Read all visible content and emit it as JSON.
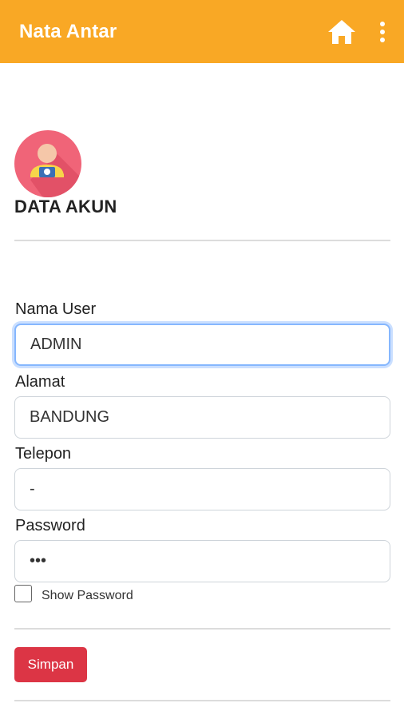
{
  "app_bar": {
    "title": "Nata Antar",
    "home_icon": "home-icon",
    "menu_icon": "more-vert-icon",
    "background_color": "#f9a825"
  },
  "profile": {
    "avatar_icon": "user-avatar-icon",
    "section_title": "DATA AKUN"
  },
  "form": {
    "nama_user": {
      "label": "Nama User",
      "value": "ADMIN"
    },
    "alamat": {
      "label": "Alamat",
      "value": "BANDUNG"
    },
    "telepon": {
      "label": "Telepon",
      "value": "-"
    },
    "password": {
      "label": "Password",
      "value": "aaa"
    },
    "show_password": {
      "label": "Show Password",
      "checked": false
    }
  },
  "actions": {
    "save_label": "Simpan",
    "save_color": "#dc3545"
  }
}
